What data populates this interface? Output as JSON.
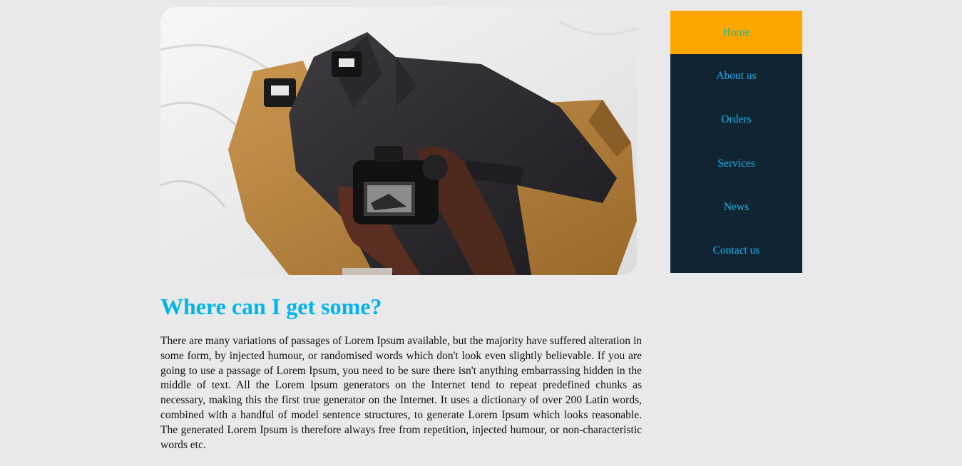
{
  "hero": {
    "image": "photo of hands holding a camera over a dark coat and a tan coat on a white bed"
  },
  "article": {
    "title": "Where can I get some?",
    "body": "There are many variations of passages of Lorem Ipsum available, but the majority have suffered alteration in some form, by injected humour, or randomised words which don't look even slightly believable. If you are going to use a passage of Lorem Ipsum, you need to be sure there isn't anything embarrassing hidden in the middle of text. All the Lorem Ipsum generators on the Internet tend to repeat predefined chunks as necessary, making this the first true generator on the Internet. It uses a dictionary of over 200 Latin words, combined with a handful of model sentence structures, to generate Lorem Ipsum which looks reasonable. The generated Lorem Ipsum is therefore always free from repetition, injected humour, or non-characteristic words etc."
  },
  "nav": {
    "items": [
      {
        "label": "Home",
        "active": true
      },
      {
        "label": "About us"
      },
      {
        "label": "Orders"
      },
      {
        "label": "Services"
      },
      {
        "label": "News"
      },
      {
        "label": "Contact us"
      }
    ]
  },
  "colors": {
    "page_background": "#e9e9e9",
    "heading": "#00b4f0",
    "nav_background": "#102434",
    "nav_active_background": "#ffa700",
    "nav_link": "#0fb6f0",
    "nav_active_link": "#12b8a0"
  }
}
